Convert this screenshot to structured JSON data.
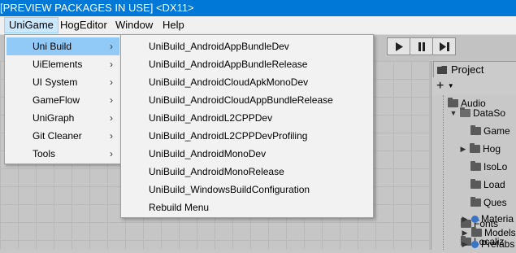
{
  "window": {
    "title": "[PREVIEW PACKAGES IN USE] <DX11>"
  },
  "menubar": {
    "items": [
      "UniGame",
      "HogEditor",
      "Window",
      "Help"
    ],
    "active": "UniGame"
  },
  "unigame_menu": {
    "items": [
      {
        "label": "Uni Build",
        "submenu": true,
        "highlighted": true
      },
      {
        "label": "UiElements",
        "submenu": true
      },
      {
        "label": "UI System",
        "submenu": true
      },
      {
        "label": "GameFlow",
        "submenu": true
      },
      {
        "label": "UniGraph",
        "submenu": true
      },
      {
        "label": "Git Cleaner",
        "submenu": true
      },
      {
        "label": "Tools",
        "submenu": true
      }
    ],
    "submenu_glyph": "›"
  },
  "unibuild_submenu": {
    "items": [
      "UniBuild_AndroidAppBundleDev",
      "UniBuild_AndroidAppBundleRelease",
      "UniBuild_AndroidCloudApkMonoDev",
      "UniBuild_AndroidCloudAppBundleRelease",
      "UniBuild_AndroidL2CPPDev",
      "UniBuild_AndroidL2CPPDevProfiling",
      "UniBuild_AndroidMonoDev",
      "UniBuild_AndroidMonoRelease",
      "UniBuild_WindowsBuildConfiguration",
      "Rebuild Menu"
    ]
  },
  "play_controls": {
    "icons": [
      "play-icon",
      "pause-icon",
      "step-icon"
    ]
  },
  "project_panel": {
    "tab_label": "Project",
    "add_label": "+",
    "tree": [
      "Audio",
      "DataSo",
      "Game",
      "Hog",
      "IsoLo",
      "Load",
      "Ques",
      "Fonts",
      "Localiz",
      "Materia",
      "Models",
      "Prefabs"
    ]
  },
  "colors": {
    "titlebar": "#0078d7",
    "menu_highlight": "#91c9f7",
    "menubar_active": "#cce8ff"
  }
}
